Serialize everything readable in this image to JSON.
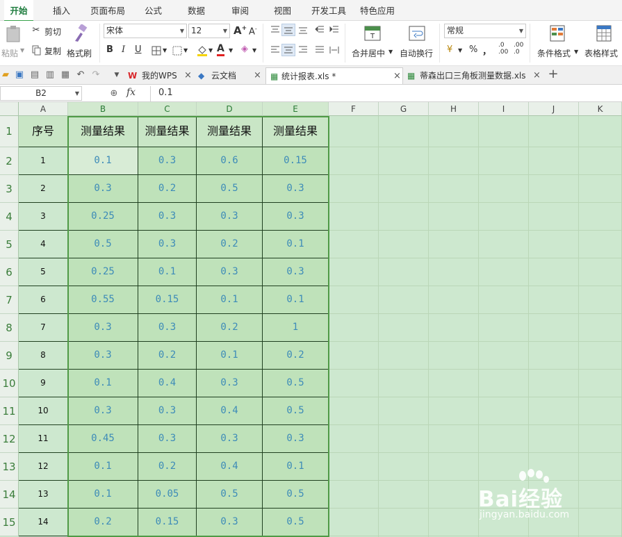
{
  "menu": {
    "tabs": [
      "开始",
      "插入",
      "页面布局",
      "公式",
      "数据",
      "审阅",
      "视图",
      "开发工具",
      "特色应用"
    ],
    "active_index": 0
  },
  "ribbon": {
    "paste": "粘贴",
    "cut": "剪切",
    "copy": "复制",
    "format_painter": "格式刷",
    "font_name": "宋体",
    "font_size": "12",
    "merge_center": "合并居中",
    "wrap_text": "自动换行",
    "number_format": "常规",
    "conditional_format": "条件格式",
    "table_style": "表格样式",
    "bold": "B",
    "italic": "I",
    "underline": "U",
    "percent": "%",
    "comma": "，"
  },
  "doc_tabs": [
    {
      "label": "我的WPS",
      "active": false
    },
    {
      "label": "云文档",
      "active": false
    },
    {
      "label": "统计报表.xls *",
      "active": true
    },
    {
      "label": "蒂森出口三角板测量数据.xls",
      "active": false
    }
  ],
  "formula_bar": {
    "name_box": "B2",
    "fx": "fx",
    "value": "0.1"
  },
  "sheet": {
    "columns": [
      "A",
      "B",
      "C",
      "D",
      "E",
      "F",
      "G",
      "H",
      "I",
      "J",
      "K"
    ],
    "row_numbers": [
      "1",
      "2",
      "3",
      "4",
      "5",
      "6",
      "7",
      "8",
      "9",
      "10",
      "11",
      "12",
      "13",
      "14",
      "15"
    ],
    "header_row": [
      "序号",
      "测量结果",
      "测量结果",
      "测量结果",
      "测量结果"
    ],
    "rows": [
      [
        "1",
        "0.1",
        "0.3",
        "0.6",
        "0.15"
      ],
      [
        "2",
        "0.3",
        "0.2",
        "0.5",
        "0.3"
      ],
      [
        "3",
        "0.25",
        "0.3",
        "0.3",
        "0.3"
      ],
      [
        "4",
        "0.5",
        "0.3",
        "0.2",
        "0.1"
      ],
      [
        "5",
        "0.25",
        "0.1",
        "0.3",
        "0.3"
      ],
      [
        "6",
        "0.55",
        "0.15",
        "0.1",
        "0.1"
      ],
      [
        "7",
        "0.3",
        "0.3",
        "0.2",
        "1"
      ],
      [
        "8",
        "0.3",
        "0.2",
        "0.1",
        "0.2"
      ],
      [
        "9",
        "0.1",
        "0.4",
        "0.3",
        "0.5"
      ],
      [
        "10",
        "0.3",
        "0.3",
        "0.4",
        "0.5"
      ],
      [
        "11",
        "0.45",
        "0.3",
        "0.3",
        "0.3"
      ],
      [
        "12",
        "0.1",
        "0.2",
        "0.4",
        "0.1"
      ],
      [
        "13",
        "0.1",
        "0.05",
        "0.5",
        "0.5"
      ],
      [
        "14",
        "0.2",
        "0.15",
        "0.3",
        "0.5"
      ]
    ],
    "active_cell": "B2",
    "selection": "B1:E15"
  },
  "watermark": {
    "brand": "Bai经验",
    "url": "jingyan.baidu.com"
  }
}
